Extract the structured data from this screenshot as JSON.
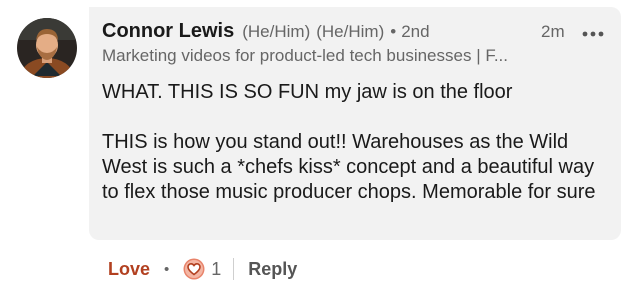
{
  "comment": {
    "author": {
      "name": "Connor Lewis",
      "pronouns": [
        "(He/Him)",
        "(He/Him)"
      ],
      "degree_separator": "•",
      "degree": "2nd",
      "headline": "Marketing videos for product-led tech businesses | F..."
    },
    "timestamp": "2m",
    "more_icon": "more-horizontal-icon",
    "body": [
      "WHAT. THIS IS SO FUN my jaw is on the floor",
      "THIS is how you stand out!! Warehouses as the Wild West is such a *chefs kiss* concept and a beautiful way to flex those music producer chops. Memorable for sure"
    ],
    "actions": {
      "love_label": "Love",
      "separator": "•",
      "reaction_icon": "love-heart-icon",
      "reaction_count": "1",
      "reply_label": "Reply"
    }
  },
  "colors": {
    "bubble_background": "#f2f2f2",
    "love_active": "#b24020",
    "secondary_text": "#666666",
    "primary_text": "#1a1a1a"
  }
}
